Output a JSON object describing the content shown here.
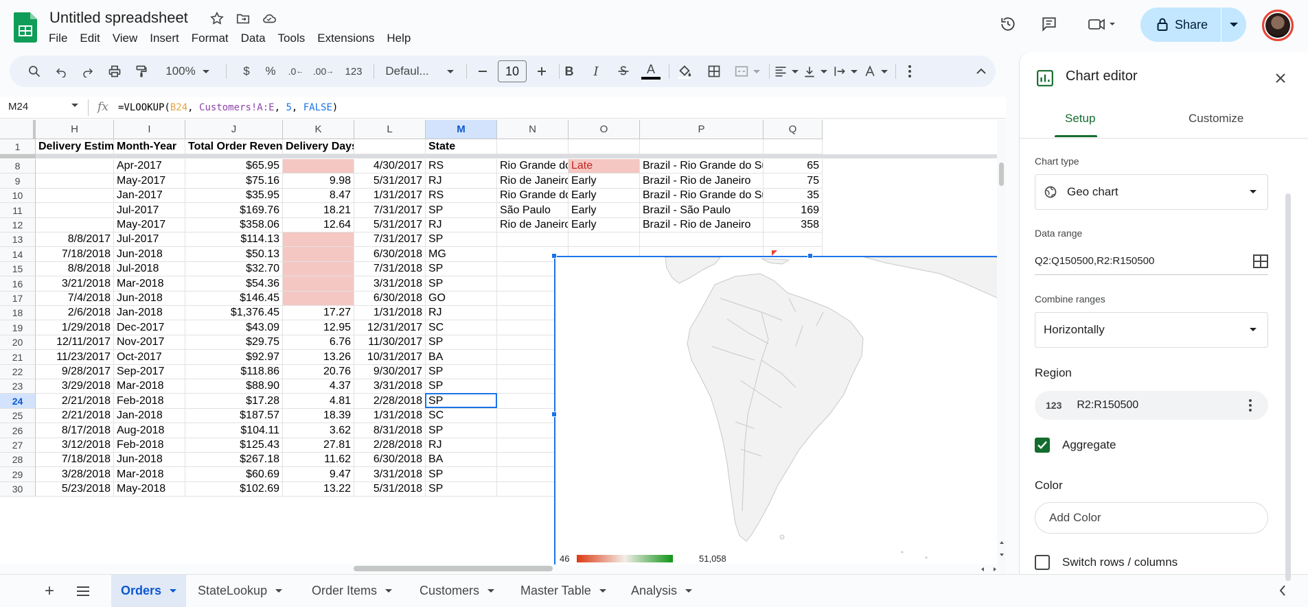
{
  "doc": {
    "title": "Untitled spreadsheet"
  },
  "menu": [
    "File",
    "Edit",
    "View",
    "Insert",
    "Format",
    "Data",
    "Tools",
    "Extensions",
    "Help"
  ],
  "share": {
    "label": "Share"
  },
  "toolbar": {
    "zoom": "100%",
    "currency": "$",
    "percent": "%",
    "dec_dec": ".0",
    "dec_inc": ".00",
    "number_format": "123",
    "font": "Defaul...",
    "font_size": "10",
    "bold": "B",
    "italic": "I",
    "text_color_letter": "A"
  },
  "formula_bar": {
    "cell_ref": "M24",
    "fx": "fx",
    "formula_parts": [
      {
        "text": "=VLOOKUP(",
        "color": "#000000"
      },
      {
        "text": "B24",
        "color": "#e8a33d"
      },
      {
        "text": ", ",
        "color": "#000000"
      },
      {
        "text": "Customers!A:E",
        "color": "#8e44ad"
      },
      {
        "text": ", ",
        "color": "#000000"
      },
      {
        "text": "5",
        "color": "#1a73e8"
      },
      {
        "text": ", ",
        "color": "#000000"
      },
      {
        "text": "FALSE",
        "color": "#1a73e8"
      },
      {
        "text": ")",
        "color": "#000000"
      }
    ]
  },
  "grid": {
    "columns": [
      "H",
      "I",
      "J",
      "K",
      "L",
      "M",
      "N",
      "O",
      "P",
      "Q"
    ],
    "selected_column": "M",
    "selected_row": "24",
    "header_row": {
      "num": "1",
      "cells": [
        "Delivery Estimate",
        "Month-Year",
        "Total Order Revenue",
        "Delivery Days",
        "",
        "State",
        "",
        "",
        "",
        ""
      ]
    },
    "rows": [
      {
        "num": "8",
        "cells": [
          "",
          "Apr-2017",
          "$65.95",
          "",
          "4/30/2017",
          "RS",
          "Rio Grande do S",
          "Late",
          "Brazil - Rio Grande do Sul",
          "65"
        ],
        "pink_k": true
      },
      {
        "num": "9",
        "cells": [
          "",
          "May-2017",
          "$75.16",
          "9.98",
          "5/31/2017",
          "RJ",
          "Rio de Janeiro",
          "Early",
          "Brazil - Rio de Janeiro",
          "75"
        ]
      },
      {
        "num": "10",
        "cells": [
          "",
          "Jan-2017",
          "$35.95",
          "8.47",
          "1/31/2017",
          "RS",
          "Rio Grande do S",
          "Early",
          "Brazil - Rio Grande do Sul",
          "35"
        ]
      },
      {
        "num": "11",
        "cells": [
          "",
          "Jul-2017",
          "$169.76",
          "18.21",
          "7/31/2017",
          "SP",
          "São Paulo",
          "Early",
          "Brazil - São Paulo",
          "169"
        ]
      },
      {
        "num": "12",
        "cells": [
          "",
          "May-2017",
          "$358.06",
          "12.64",
          "5/31/2017",
          "RJ",
          "Rio de Janeiro",
          "Early",
          "Brazil - Rio de Janeiro",
          "358"
        ]
      },
      {
        "num": "13",
        "cells": [
          "8/8/2017",
          "Jul-2017",
          "$114.13",
          "",
          "7/31/2017",
          "SP"
        ],
        "pink_k": true
      },
      {
        "num": "14",
        "cells": [
          "7/18/2018",
          "Jun-2018",
          "$50.13",
          "",
          "6/30/2018",
          "MG"
        ],
        "pink_k": true
      },
      {
        "num": "15",
        "cells": [
          "8/8/2018",
          "Jul-2018",
          "$32.70",
          "",
          "7/31/2018",
          "SP"
        ],
        "pink_k": true
      },
      {
        "num": "16",
        "cells": [
          "3/21/2018",
          "Mar-2018",
          "$54.36",
          "",
          "3/31/2018",
          "SP"
        ],
        "pink_k": true
      },
      {
        "num": "17",
        "cells": [
          "7/4/2018",
          "Jun-2018",
          "$146.45",
          "",
          "6/30/2018",
          "GO"
        ],
        "pink_k": true
      },
      {
        "num": "18",
        "cells": [
          "2/6/2018",
          "Jan-2018",
          "$1,376.45",
          "17.27",
          "1/31/2018",
          "RJ"
        ]
      },
      {
        "num": "19",
        "cells": [
          "1/29/2018",
          "Dec-2017",
          "$43.09",
          "12.95",
          "12/31/2017",
          "SC"
        ]
      },
      {
        "num": "20",
        "cells": [
          "12/11/2017",
          "Nov-2017",
          "$29.75",
          "6.76",
          "11/30/2017",
          "SP"
        ]
      },
      {
        "num": "21",
        "cells": [
          "11/23/2017",
          "Oct-2017",
          "$92.97",
          "13.26",
          "10/31/2017",
          "BA"
        ]
      },
      {
        "num": "22",
        "cells": [
          "9/28/2017",
          "Sep-2017",
          "$118.86",
          "20.76",
          "9/30/2017",
          "SP"
        ]
      },
      {
        "num": "23",
        "cells": [
          "3/29/2018",
          "Mar-2018",
          "$88.90",
          "4.37",
          "3/31/2018",
          "SP"
        ]
      },
      {
        "num": "24",
        "cells": [
          "2/21/2018",
          "Feb-2018",
          "$17.28",
          "4.81",
          "2/28/2018",
          "SP"
        ]
      },
      {
        "num": "25",
        "cells": [
          "2/21/2018",
          "Jan-2018",
          "$187.57",
          "18.39",
          "1/31/2018",
          "SC"
        ]
      },
      {
        "num": "26",
        "cells": [
          "8/17/2018",
          "Aug-2018",
          "$104.11",
          "3.62",
          "8/31/2018",
          "SP"
        ]
      },
      {
        "num": "27",
        "cells": [
          "3/12/2018",
          "Feb-2018",
          "$125.43",
          "27.81",
          "2/28/2018",
          "RJ"
        ]
      },
      {
        "num": "28",
        "cells": [
          "7/18/2018",
          "Jun-2018",
          "$267.18",
          "11.62",
          "6/30/2018",
          "BA"
        ]
      },
      {
        "num": "29",
        "cells": [
          "3/28/2018",
          "Mar-2018",
          "$60.69",
          "9.47",
          "3/31/2018",
          "SP"
        ]
      },
      {
        "num": "30",
        "cells": [
          "5/23/2018",
          "May-2018",
          "$102.69",
          "13.22",
          "5/31/2018",
          "SP"
        ]
      }
    ]
  },
  "chart": {
    "legend_min": "46",
    "legend_max": "51,058",
    "min_color": "#dc3912",
    "max_color": "#109618"
  },
  "sheets": [
    {
      "label": "Orders",
      "active": true
    },
    {
      "label": "StateLookup"
    },
    {
      "label": "Order Items"
    },
    {
      "label": "Customers"
    },
    {
      "label": "Master Table"
    },
    {
      "label": "Analysis"
    }
  ],
  "chart_editor": {
    "title": "Chart editor",
    "tabs": [
      "Setup",
      "Customize"
    ],
    "chart_type_label": "Chart type",
    "chart_type": "Geo chart",
    "data_range_label": "Data range",
    "data_range": "Q2:Q150500,R2:R150500",
    "combine_label": "Combine ranges",
    "combine_value": "Horizontally",
    "region_label": "Region",
    "region_range": "R2:R150500",
    "aggregate_label": "Aggregate",
    "aggregate_checked": true,
    "color_label": "Color",
    "add_color": "Add Color",
    "switch_label": "Switch rows / columns",
    "switch_checked": false
  },
  "colors": {
    "accent_blue": "#1a73e8",
    "share_bg": "#c2e7ff",
    "editor_green": "#146c2e",
    "late_pink": "#f4c7c3"
  }
}
